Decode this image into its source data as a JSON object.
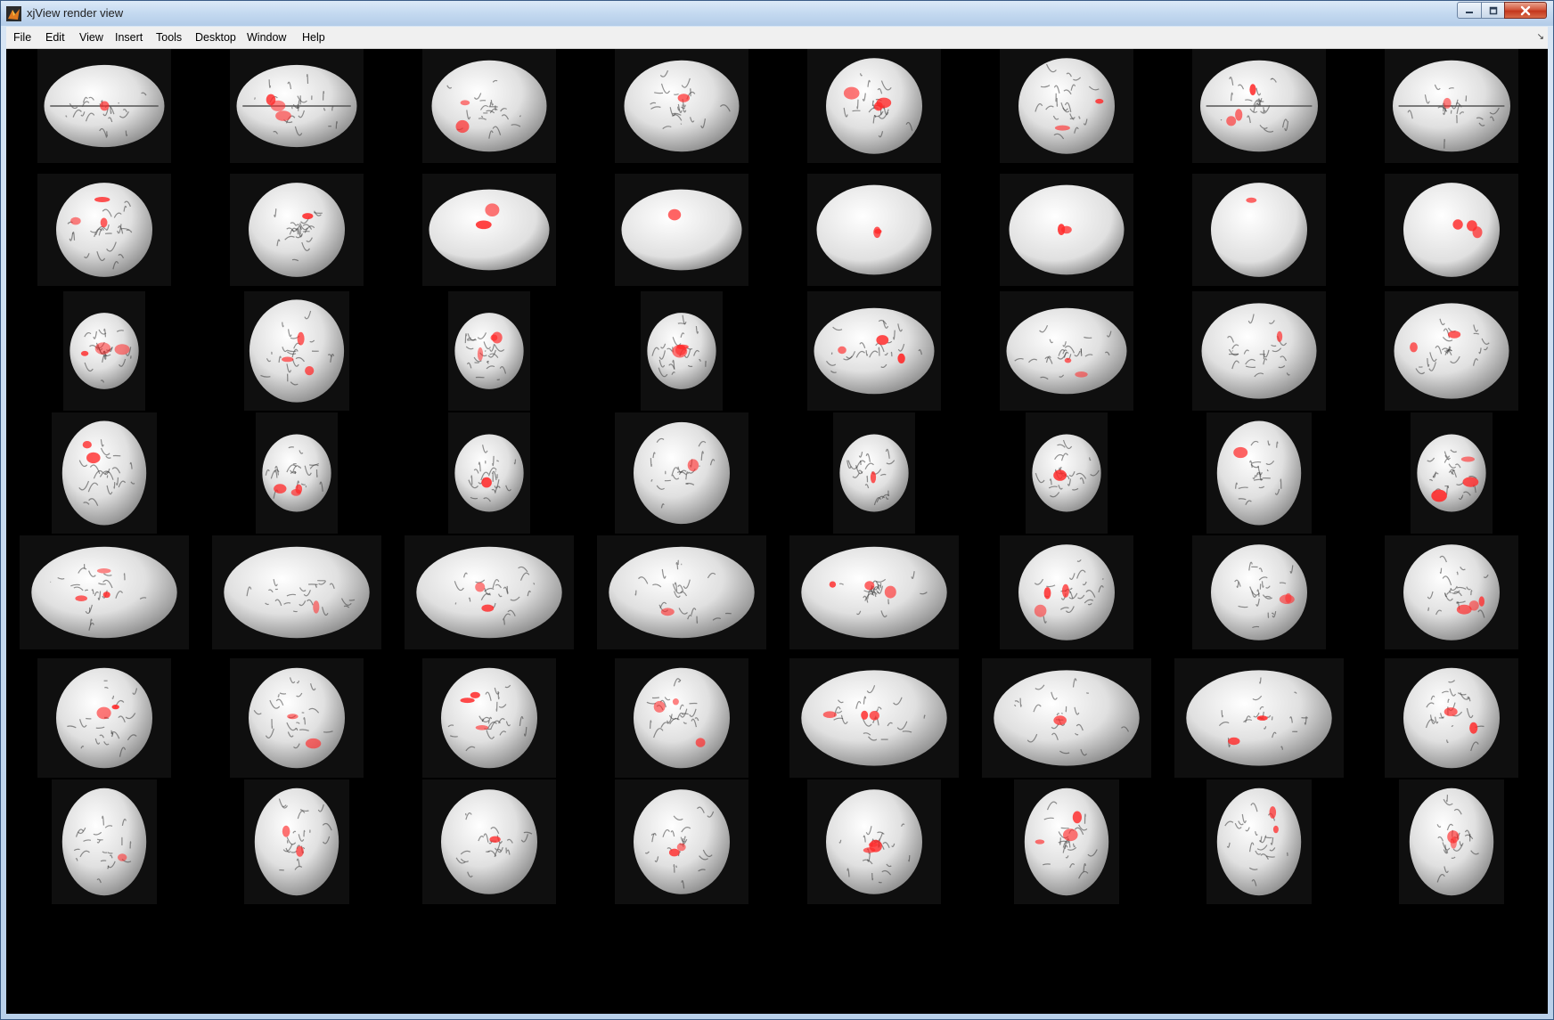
{
  "window": {
    "title": "xjView render view",
    "icon": "matlab-icon",
    "controls": [
      "minimize-icon",
      "maximize-icon",
      "close-icon"
    ]
  },
  "menubar": {
    "items": [
      "File",
      "Edit",
      "View",
      "Insert",
      "Tools",
      "Desktop",
      "Window",
      "Help"
    ],
    "dock_arrow_icon": "dock-arrow-icon"
  },
  "render": {
    "background": "#000000",
    "brain_color": "#e0e0e0",
    "activation_color": "#ff2a2a",
    "rows": 7,
    "columns": 8,
    "image_count": 56
  }
}
